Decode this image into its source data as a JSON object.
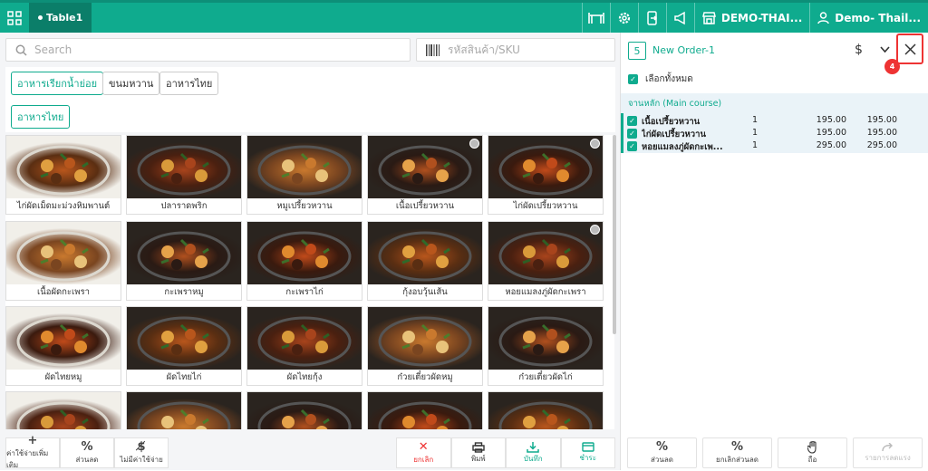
{
  "topbar": {
    "table_tab": "Table1",
    "store_name": "DEMO-THAI...",
    "user_name": "Demo- Thail..."
  },
  "search": {
    "placeholder": "Search"
  },
  "sku": {
    "placeholder": "รหัสสินค้า/SKU"
  },
  "categories": {
    "row1": [
      "อาหารเรียกน้ำย่อย",
      "ขนมหวาน",
      "อาหารไทย"
    ],
    "row2": [
      "อาหารไทย"
    ]
  },
  "products": [
    {
      "name": "ไก่ผัดเม็ดมะม่วงหิมพานต์",
      "checked": false
    },
    {
      "name": "ปลาราดพริก",
      "checked": false
    },
    {
      "name": "หมูเปรี้ยวหวาน",
      "checked": false
    },
    {
      "name": "เนื้อเปรี้ยวหวาน",
      "checked": true
    },
    {
      "name": "ไก่ผัดเปรี้ยวหวาน",
      "checked": true
    },
    {
      "name": "เนื้อผัดกะเพรา",
      "checked": false
    },
    {
      "name": "กะเพราหมู",
      "checked": false
    },
    {
      "name": "กะเพราไก่",
      "checked": false
    },
    {
      "name": "กุ้งอบวุ้นเส้น",
      "checked": false
    },
    {
      "name": "หอยแมลงภู่ผัดกะเพรา",
      "checked": true
    },
    {
      "name": "ผัดไทยหมู",
      "checked": false
    },
    {
      "name": "ผัดไทยไก่",
      "checked": false
    },
    {
      "name": "ผัดไทยกุ้ง",
      "checked": false
    },
    {
      "name": "ก๋วยเตี๋ยวผัดหมู",
      "checked": false
    },
    {
      "name": "ก๋วยเตี๋ยวผัดไก่",
      "checked": false
    },
    {
      "name": "",
      "checked": false
    },
    {
      "name": "",
      "checked": false
    },
    {
      "name": "",
      "checked": false
    },
    {
      "name": "",
      "checked": false
    },
    {
      "name": "",
      "checked": false
    }
  ],
  "left_actions": [
    "ค่าใช้จ่ายเพิ่มเติม",
    "ส่วนลด",
    "ไม่มีค่าใช้จ่าย"
  ],
  "right_actions": [
    "ยกเลิก",
    "พิมพ์",
    "บันทึก",
    "ชำระ"
  ],
  "order": {
    "number": "5",
    "name": "New Order-1",
    "currency_symbol": "$",
    "badge": "4",
    "select_all": "เลือกทั้งหมด",
    "course": "จานหลัก (Main course)",
    "items": [
      {
        "name": "เนื้อเปรี้ยวหวาน",
        "qty": "1",
        "price": "195.00",
        "total": "195.00"
      },
      {
        "name": "ไก่ผัดเปรี้ยวหวาน",
        "qty": "1",
        "price": "195.00",
        "total": "195.00"
      },
      {
        "name": "หอยแมลงภู่ผัดกะเพ...",
        "qty": "1",
        "price": "295.00",
        "total": "295.00"
      }
    ]
  },
  "order_actions": [
    "ส่วนลด",
    "ยกเลิกส่วนลด",
    "ถือ",
    "รายการลดแรง"
  ],
  "colors": {
    "accent": "#0fab8e",
    "danger": "#e33333",
    "highlight": "#eaf3f8"
  }
}
